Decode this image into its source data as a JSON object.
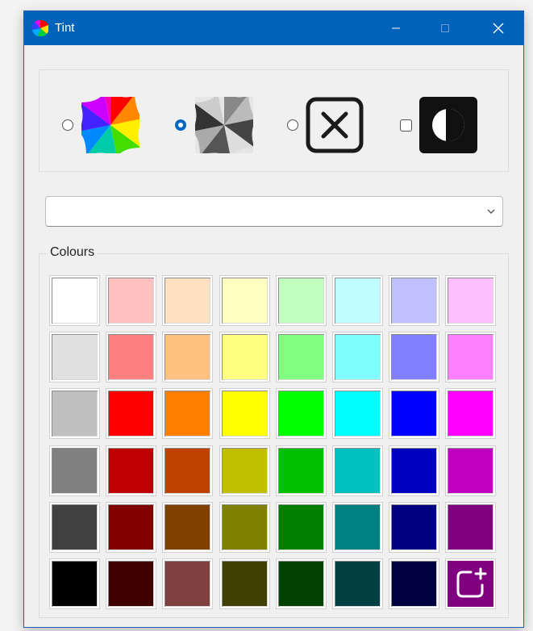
{
  "window": {
    "title": "Tint",
    "accent": "#0062b8"
  },
  "titlebar_controls": [
    "minimize-icon",
    "maximize-icon",
    "close-icon"
  ],
  "modes": [
    {
      "name": "rainbow-swirl-icon",
      "control": "radio",
      "selected": false
    },
    {
      "name": "greyscale-swirl-icon",
      "control": "radio",
      "selected": true
    },
    {
      "name": "no-tint-icon",
      "control": "radio",
      "selected": false
    },
    {
      "name": "invert-contrast-icon",
      "control": "checkbox",
      "checked": false
    }
  ],
  "dropdown": {
    "value": ""
  },
  "colours": {
    "label": "Colours",
    "rows": [
      [
        "#ffffff",
        "#ffc0c0",
        "#ffe0c0",
        "#ffffc0",
        "#c0ffc0",
        "#c0ffff",
        "#c0c0ff",
        "#ffc0ff"
      ],
      [
        "#e0e0e0",
        "#ff8080",
        "#ffc080",
        "#ffff80",
        "#80ff80",
        "#80ffff",
        "#8080ff",
        "#ff80ff"
      ],
      [
        "#c0c0c0",
        "#ff0000",
        "#ff8000",
        "#ffff00",
        "#00ff00",
        "#00ffff",
        "#0000ff",
        "#ff00ff"
      ],
      [
        "#808080",
        "#c00000",
        "#c04000",
        "#c0c000",
        "#00c000",
        "#00c0c0",
        "#0000c0",
        "#c000c0"
      ],
      [
        "#404040",
        "#800000",
        "#804000",
        "#808000",
        "#008000",
        "#008080",
        "#000080",
        "#800080"
      ],
      [
        "#000000",
        "#400000",
        "#804040",
        "#404000",
        "#004000",
        "#004040",
        "#000040"
      ]
    ],
    "add_custom": {
      "icon": "add-custom-colour-icon",
      "color": "#800080"
    }
  }
}
